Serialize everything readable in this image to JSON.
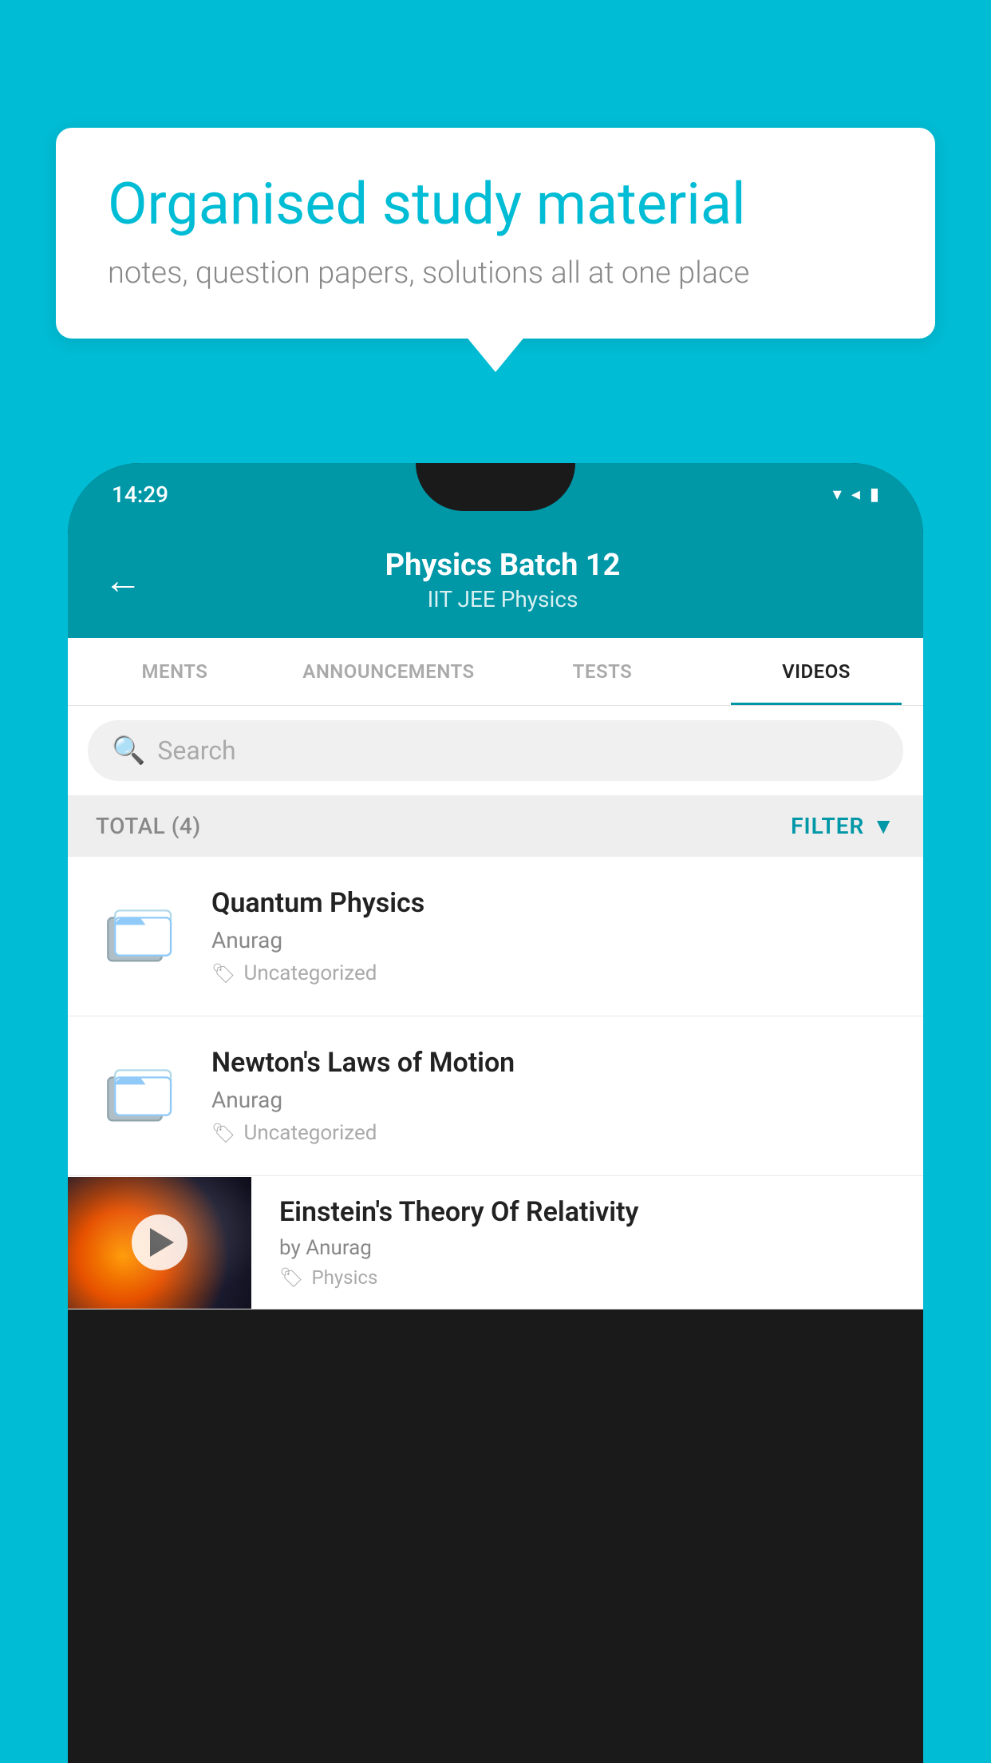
{
  "background_color": "#00bcd4",
  "speech_bubble": {
    "headline": "Organised study material",
    "subtext": "notes, question papers, solutions all at one place"
  },
  "phone": {
    "status_bar": {
      "time": "14:29",
      "wifi_icon": "▾",
      "signal_icon": "◂",
      "battery_icon": "▮"
    },
    "app_bar": {
      "back_label": "←",
      "title": "Physics Batch 12",
      "subtitle": "IIT JEE   Physics"
    },
    "tabs": [
      {
        "label": "MENTS",
        "active": false
      },
      {
        "label": "ANNOUNCEMENTS",
        "active": false
      },
      {
        "label": "TESTS",
        "active": false
      },
      {
        "label": "VIDEOS",
        "active": true
      }
    ],
    "search": {
      "placeholder": "Search"
    },
    "filter_row": {
      "total_label": "TOTAL (4)",
      "filter_label": "FILTER"
    },
    "videos": [
      {
        "title": "Quantum Physics",
        "author": "Anurag",
        "tag": "Uncategorized",
        "type": "folder",
        "has_thumb": false
      },
      {
        "title": "Newton's Laws of Motion",
        "author": "Anurag",
        "tag": "Uncategorized",
        "type": "folder",
        "has_thumb": false
      },
      {
        "title": "Einstein's Theory Of Relativity",
        "author": "by Anurag",
        "tag": "Physics",
        "type": "video",
        "has_thumb": true
      }
    ]
  }
}
